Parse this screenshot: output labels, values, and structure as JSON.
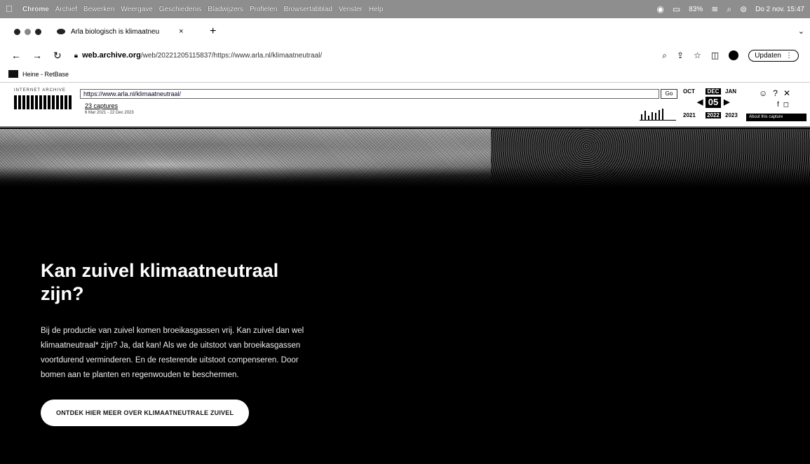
{
  "menubar": {
    "app_name": "Chrome",
    "items": [
      "Archief",
      "Bewerken",
      "Weergave",
      "Geschiedenis",
      "Bladwijzers",
      "Profielen",
      "Browsertabblad",
      "Venster",
      "Help"
    ],
    "clock": "Do 2 nov. 15:47",
    "battery": "83%"
  },
  "tab": {
    "title": "Arla biologisch is klimaatneu",
    "close": "×",
    "new_tab": "+"
  },
  "address_bar": {
    "domain": "web.archive.org",
    "path": "/web/20221205115837/https://www.arla.nl/klimaatneutraal/",
    "update_label": "Updaten",
    "menu": "⋮"
  },
  "bookmarks": {
    "items": [
      "Heine - RetBase"
    ]
  },
  "wayback": {
    "brand": "INTERNET ARCHIVE",
    "url_value": "https://www.arla.nl/klimaatneutraal/",
    "go_label": "Go",
    "captures_label": "23 captures",
    "date_range": "6 Mar 2021 - 22 Dec 2023",
    "months": {
      "prev": "OCT",
      "current": "DEC",
      "next": "JAN"
    },
    "day": "05",
    "years": {
      "prev": "2021",
      "current": "2022",
      "next": "2023"
    },
    "about_label": "About this capture",
    "sparkline": [
      0.5,
      0.8,
      0.4,
      0.7,
      0.6,
      0.9,
      1.0
    ]
  },
  "page": {
    "headline": "Kan zuivel klimaatneutraal zijn?",
    "body": "Bij de productie van zuivel komen broeikasgassen vrij. Kan zuivel dan wel klimaatneutraal* zijn? Ja, dat kan! Als we de uitstoot van broeikasgassen voortdurend verminderen. En de resterende uitstoot compenseren. Door bomen aan te planten en regenwouden te beschermen.",
    "cta_label": "ONTDEK HIER MEER OVER KLIMAATNEUTRALE ZUIVEL"
  }
}
